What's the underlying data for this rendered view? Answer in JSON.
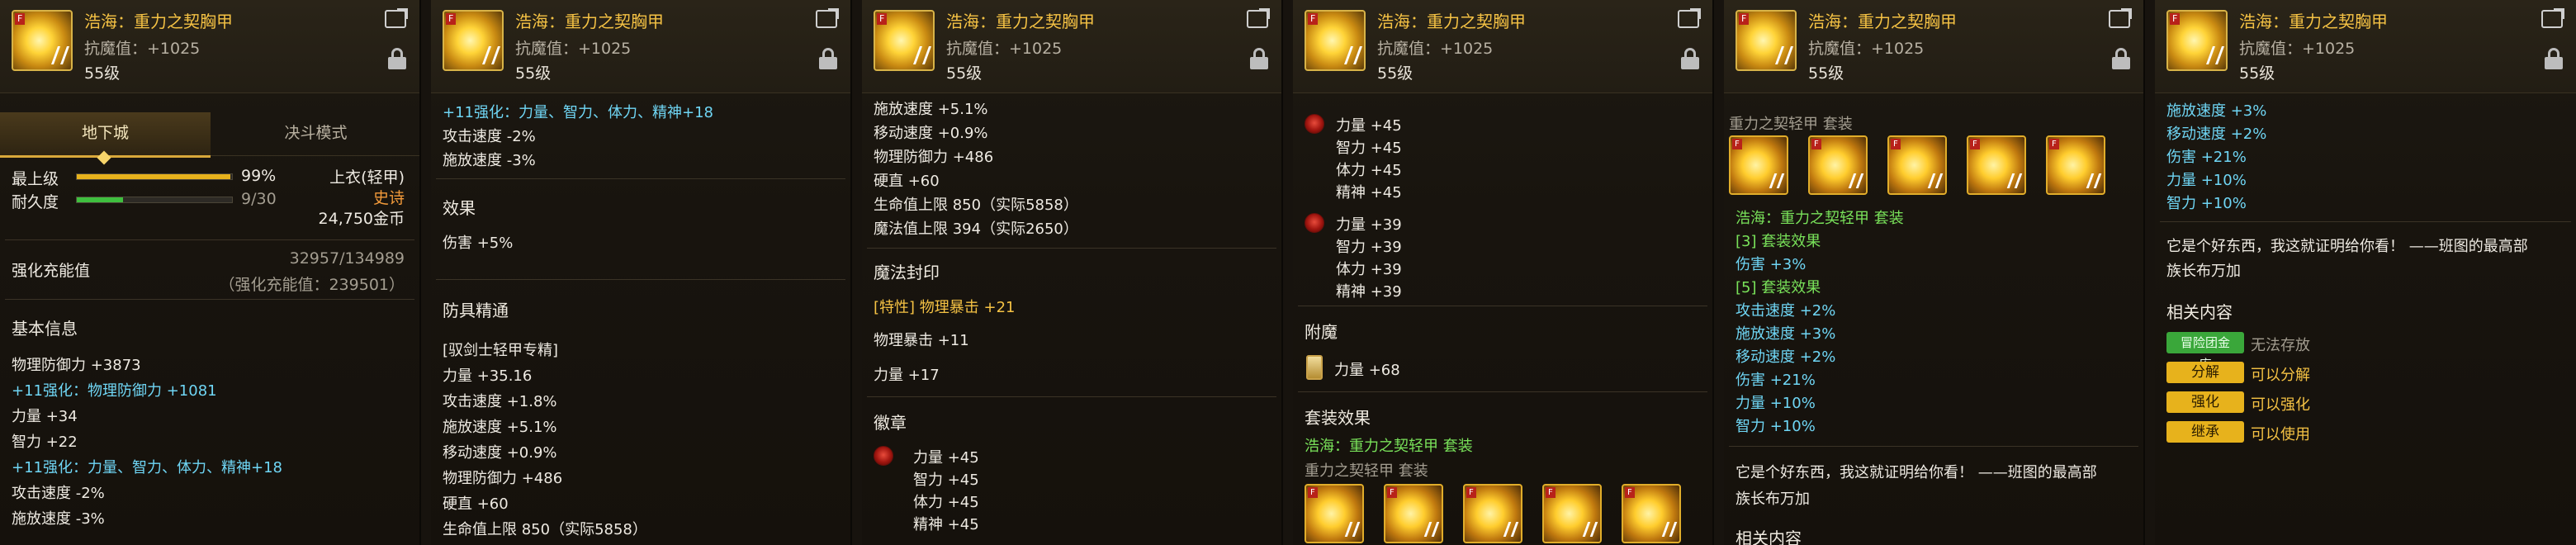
{
  "item": {
    "name": "浩海：重力之契胸甲",
    "magic_res": "抗魔值：+1025",
    "level": "55级",
    "icon_tag": "F"
  },
  "p1": {
    "tab_active": "地下城",
    "tab_other": "决斗模式",
    "max_level_label": "最上级",
    "max_level_value": "99%",
    "max_level_fraction": 0.99,
    "durability_label": "耐久度",
    "durability_value": "9/30",
    "durability_fraction": 0.3,
    "slot": "上衣(轻甲)",
    "rarity": "史诗",
    "price": "24,750金币",
    "reinforce_title": "强化充能值",
    "reinforce_value": "32957/134989",
    "reinforce_sub": "（强化充能值：239501）",
    "basic_title": "基本信息",
    "lines": [
      {
        "text": "物理防御力 +3873",
        "color": "white"
      },
      {
        "text": "+11强化：物理防御力 +1081",
        "color": "cyan"
      },
      {
        "text": "力量 +34",
        "color": "white"
      },
      {
        "text": "智力 +22",
        "color": "white"
      },
      {
        "text": "+11强化：力量、智力、体力、精神+18",
        "color": "cyan"
      },
      {
        "text": "攻击速度 -2%",
        "color": "white"
      },
      {
        "text": "施放速度 -3%",
        "color": "white"
      }
    ]
  },
  "p2": {
    "top_lines": [
      {
        "text": "+11强化：力量、智力、体力、精神+18",
        "color": "cyan"
      },
      {
        "text": "攻击速度 -2%",
        "color": "white"
      },
      {
        "text": "施放速度 -3%",
        "color": "white"
      }
    ],
    "effect_title": "效果",
    "effect_line": "伤害 +5%",
    "mastery_title": "防具精通",
    "mastery_lines": [
      "[驭剑士轻甲专精]",
      "力量 +35.16",
      "攻击速度 +1.8%",
      "施放速度 +5.1%",
      "移动速度 +0.9%",
      "物理防御力 +486",
      "硬直 +60",
      "生命值上限 850（实际5858）",
      "魔法值上限 394（实际2650）"
    ]
  },
  "p3": {
    "top_lines": [
      "施放速度 +5.1%",
      "移动速度 +0.9%",
      "物理防御力 +486",
      "硬直 +60",
      "生命值上限 850（实际5858）",
      "魔法值上限 394（实际2650）"
    ],
    "seal_title": "魔法封印",
    "seal_trait": "[特性] 物理暴击 +21",
    "seal_line1": "物理暴击 +11",
    "seal_line2": "力量 +17",
    "emblem_title": "徽章",
    "emblem_lines": [
      "力量 +45",
      "智力 +45",
      "体力 +45",
      "精神 +45"
    ]
  },
  "p4": {
    "emblem1": [
      "力量 +45",
      "智力 +45",
      "体力 +45",
      "精神 +45"
    ],
    "emblem2": [
      "力量 +39",
      "智力 +39",
      "体力 +39",
      "精神 +39"
    ],
    "enchant_title": "附魔",
    "enchant_line": "力量 +68",
    "set_title": "套装效果",
    "set_name": "浩海：重力之契轻甲 套装",
    "set_sub": "重力之契轻甲 套装"
  },
  "p5": {
    "set_sub": "重力之契轻甲 套装",
    "set_name": "浩海：重力之契轻甲 套装",
    "set3": "[3] 套装效果",
    "set3_line": "伤害 +3%",
    "set5": "[5] 套装效果",
    "set5_lines": [
      "攻击速度 +2%",
      "施放速度 +3%",
      "移动速度 +2%",
      "伤害 +21%",
      "力量 +10%",
      "智力 +10%"
    ],
    "flavor1": "它是个好东西，我这就证明给你看！ ——班图的最高部",
    "flavor2": "族长布万加",
    "related_title": "相关内容"
  },
  "p6": {
    "top_lines": [
      "施放速度 +3%",
      "移动速度 +2%",
      "伤害 +21%",
      "力量 +10%",
      "智力 +10%"
    ],
    "flavor1": "它是个好东西，我这就证明给你看！ ——班图的最高部",
    "flavor2": "族长布万加",
    "related_title": "相关内容",
    "actions": [
      {
        "button": "冒险团金库",
        "desc": "无法存放",
        "style": "green"
      },
      {
        "button": "分解",
        "desc": "可以分解",
        "style": "gold"
      },
      {
        "button": "强化",
        "desc": "可以强化",
        "style": "gold"
      },
      {
        "button": "继承",
        "desc": "可以使用",
        "style": "gold"
      }
    ]
  }
}
